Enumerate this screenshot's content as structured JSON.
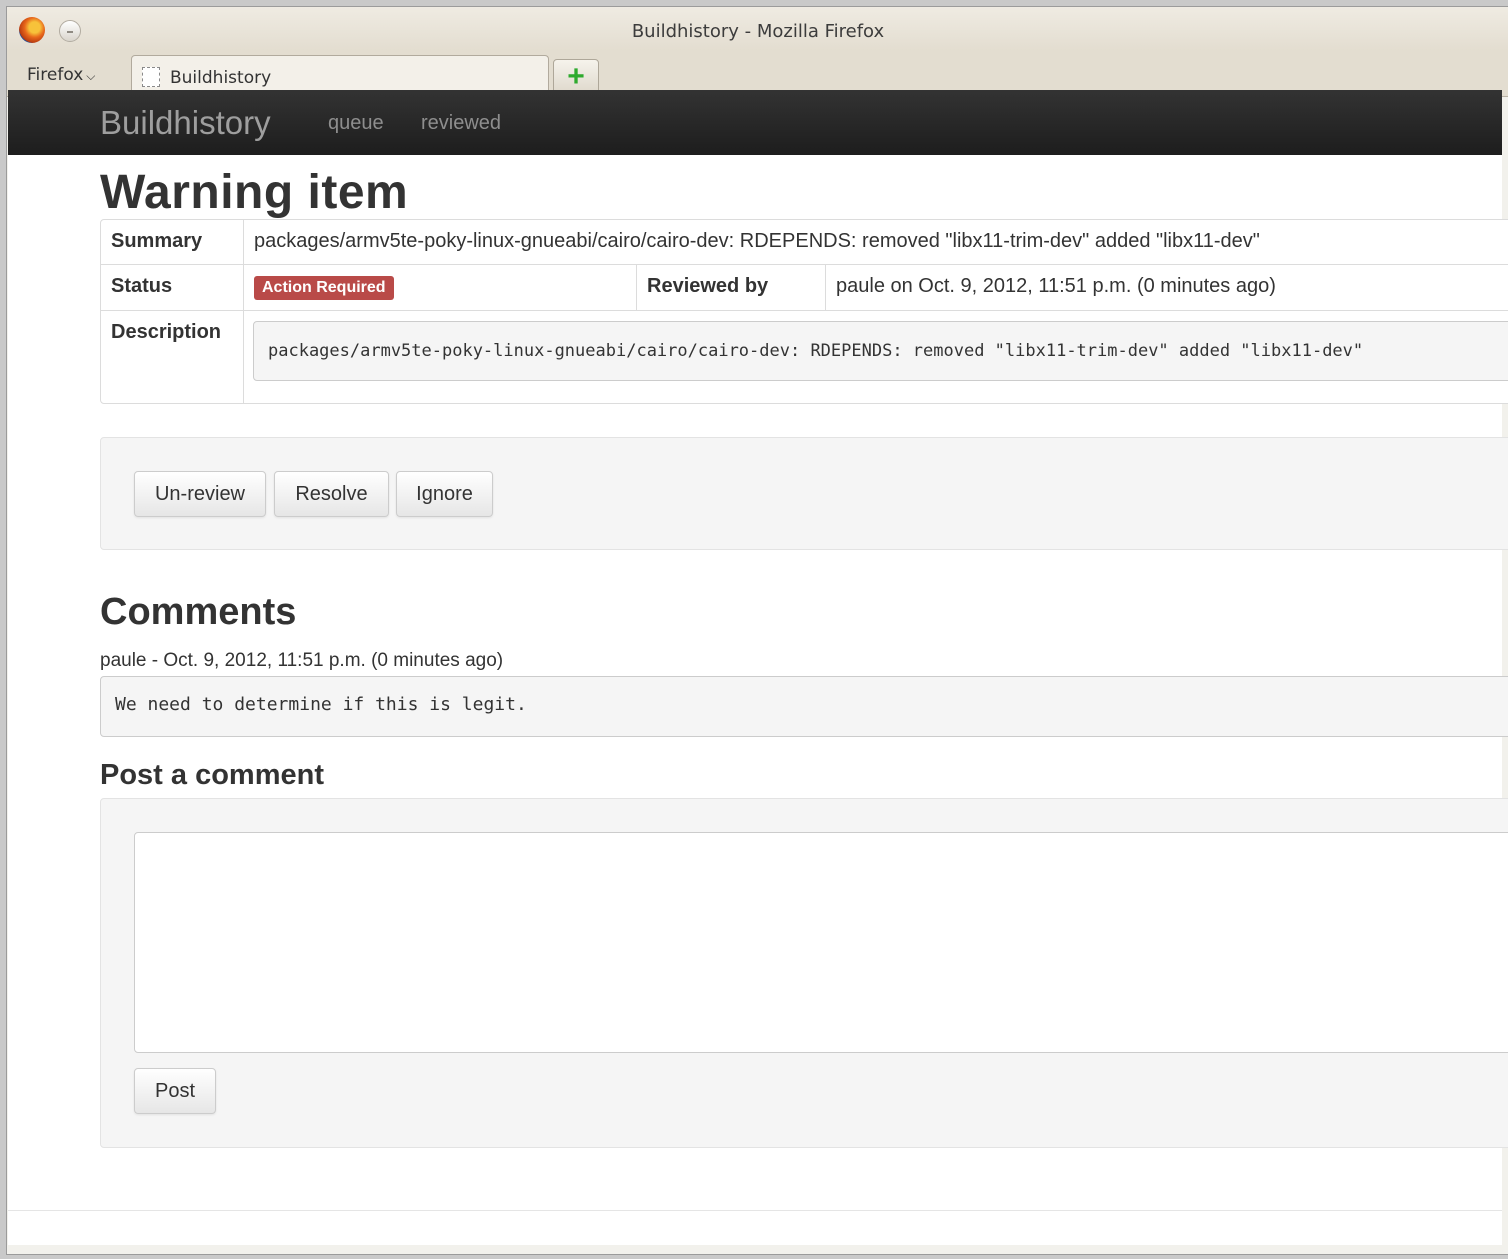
{
  "window": {
    "title": "Buildhistory - Mozilla Firefox",
    "menu_label": "Firefox",
    "tab_label": "Buildhistory",
    "new_tab_symbol": "+"
  },
  "navbar": {
    "brand": "Buildhistory",
    "links": [
      "queue",
      "reviewed"
    ]
  },
  "page": {
    "title": "Warning item",
    "summary_label": "Summary",
    "summary_value": "packages/armv5te-poky-linux-gnueabi/cairo/cairo-dev: RDEPENDS: removed \"libx11-trim-dev\" added \"libx11-dev\"",
    "status_label": "Status",
    "status_badge": "Action Required",
    "status_badge_color": "#b94a48",
    "reviewed_by_label": "Reviewed by",
    "reviewed_by_value": "paule on Oct. 9, 2012, 11:51 p.m. (0 minutes ago)",
    "description_label": "Description",
    "description_value": "packages/armv5te-poky-linux-gnueabi/cairo/cairo-dev: RDEPENDS: removed \"libx11-trim-dev\" added \"libx11-dev\"",
    "actions": [
      "Un-review",
      "Resolve",
      "Ignore"
    ]
  },
  "comments": {
    "heading": "Comments",
    "items": [
      {
        "meta": "paule - Oct. 9, 2012, 11:51 p.m. (0 minutes ago)",
        "text": "We need to determine if this is legit."
      }
    ]
  },
  "post_comment": {
    "heading": "Post a comment",
    "textarea_value": "",
    "button_label": "Post"
  }
}
